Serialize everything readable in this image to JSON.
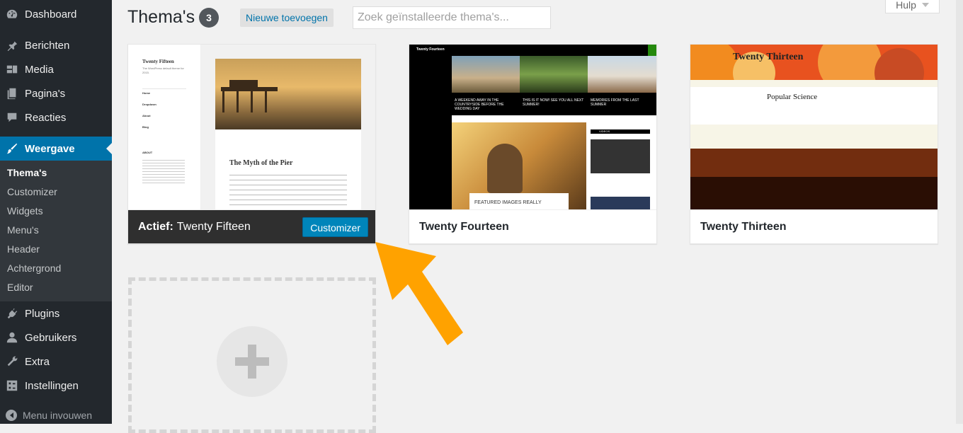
{
  "sidebar": {
    "items": [
      {
        "label": "Dashboard",
        "icon": "dashboard-icon"
      },
      {
        "label": "Berichten",
        "icon": "pin-icon"
      },
      {
        "label": "Media",
        "icon": "media-icon"
      },
      {
        "label": "Pagina's",
        "icon": "pages-icon"
      },
      {
        "label": "Reacties",
        "icon": "comments-icon"
      },
      {
        "label": "Weergave",
        "icon": "appearance-icon"
      },
      {
        "label": "Plugins",
        "icon": "plugins-icon"
      },
      {
        "label": "Gebruikers",
        "icon": "users-icon"
      },
      {
        "label": "Extra",
        "icon": "tools-icon"
      },
      {
        "label": "Instellingen",
        "icon": "settings-icon"
      }
    ],
    "submenu": [
      "Thema's",
      "Customizer",
      "Widgets",
      "Menu's",
      "Header",
      "Achtergrond",
      "Editor"
    ],
    "collapse_label": "Menu invouwen"
  },
  "header": {
    "title": "Thema's",
    "count": "3",
    "add_new_label": "Nieuwe toevoegen",
    "search_placeholder": "Zoek geïnstalleerde thema's...",
    "help_label": "Hulp"
  },
  "themes": [
    {
      "active_prefix": "Actief:",
      "name": "Twenty Fifteen",
      "customize_label": "Customizer",
      "preview": {
        "site_title": "Twenty Fifteen",
        "tagline": "The WordPress default theme for 2015.",
        "nav": [
          "Home",
          "Dropdown",
          "About",
          "Blog"
        ],
        "widget_title": "ABOUT",
        "post_title": "The Myth of the Pier"
      }
    },
    {
      "name": "Twenty Fourteen",
      "preview": {
        "site_title": "Twenty Fourteen",
        "captions": [
          "A WEEKEND AWAY IN THE COUNTRYSIDE BEFORE THE WEDDING DAY",
          "THIS IS IT NOW! SEE YOU ALL NEXT SUMMER!",
          "MEMORIES FROM THE LAST SUMMER"
        ],
        "featured": "FEATURED IMAGES REALLY",
        "video_label": "VIDEOS"
      }
    },
    {
      "name": "Twenty Thirteen",
      "preview": {
        "site_title": "Twenty Thirteen",
        "post_title": "Popular Science"
      }
    }
  ],
  "colors": {
    "sidebar_bg": "#23282d",
    "active_menu": "#0073aa",
    "button_blue": "#0085ba",
    "arrow": "#ffa200"
  }
}
